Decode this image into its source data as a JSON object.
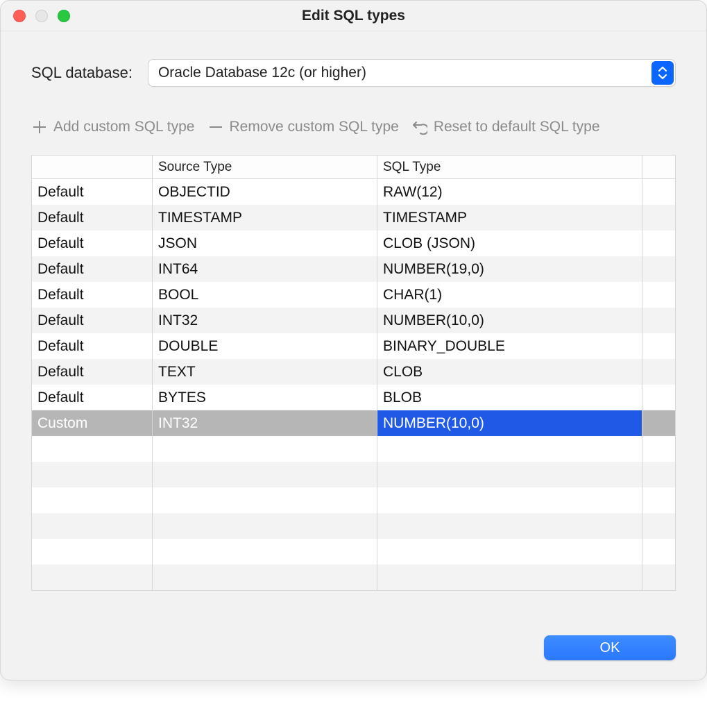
{
  "title": "Edit SQL types",
  "db_label": "SQL database:",
  "db_selected": "Oracle Database 12c (or higher)",
  "toolbar": {
    "add_label": "Add custom SQL type",
    "remove_label": "Remove custom SQL type",
    "reset_label": "Reset to default SQL type"
  },
  "columns": {
    "c0": "",
    "c1": "Source Type",
    "c2": "SQL Type",
    "c3": ""
  },
  "rows": [
    {
      "kind": "Default",
      "source": "OBJECTID",
      "sql": "RAW(12)",
      "selected": false
    },
    {
      "kind": "Default",
      "source": "TIMESTAMP",
      "sql": "TIMESTAMP",
      "selected": false
    },
    {
      "kind": "Default",
      "source": "JSON",
      "sql": "CLOB (JSON)",
      "selected": false
    },
    {
      "kind": "Default",
      "source": "INT64",
      "sql": "NUMBER(19,0)",
      "selected": false
    },
    {
      "kind": "Default",
      "source": "BOOL",
      "sql": "CHAR(1)",
      "selected": false
    },
    {
      "kind": "Default",
      "source": "INT32",
      "sql": "NUMBER(10,0)",
      "selected": false
    },
    {
      "kind": "Default",
      "source": "DOUBLE",
      "sql": "BINARY_DOUBLE",
      "selected": false
    },
    {
      "kind": "Default",
      "source": "TEXT",
      "sql": "CLOB",
      "selected": false
    },
    {
      "kind": "Default",
      "source": "BYTES",
      "sql": "BLOB",
      "selected": false
    },
    {
      "kind": "Custom",
      "source": "INT32",
      "sql": "NUMBER(10,0)",
      "selected": true
    }
  ],
  "empty_rows": 6,
  "ok_label": "OK"
}
